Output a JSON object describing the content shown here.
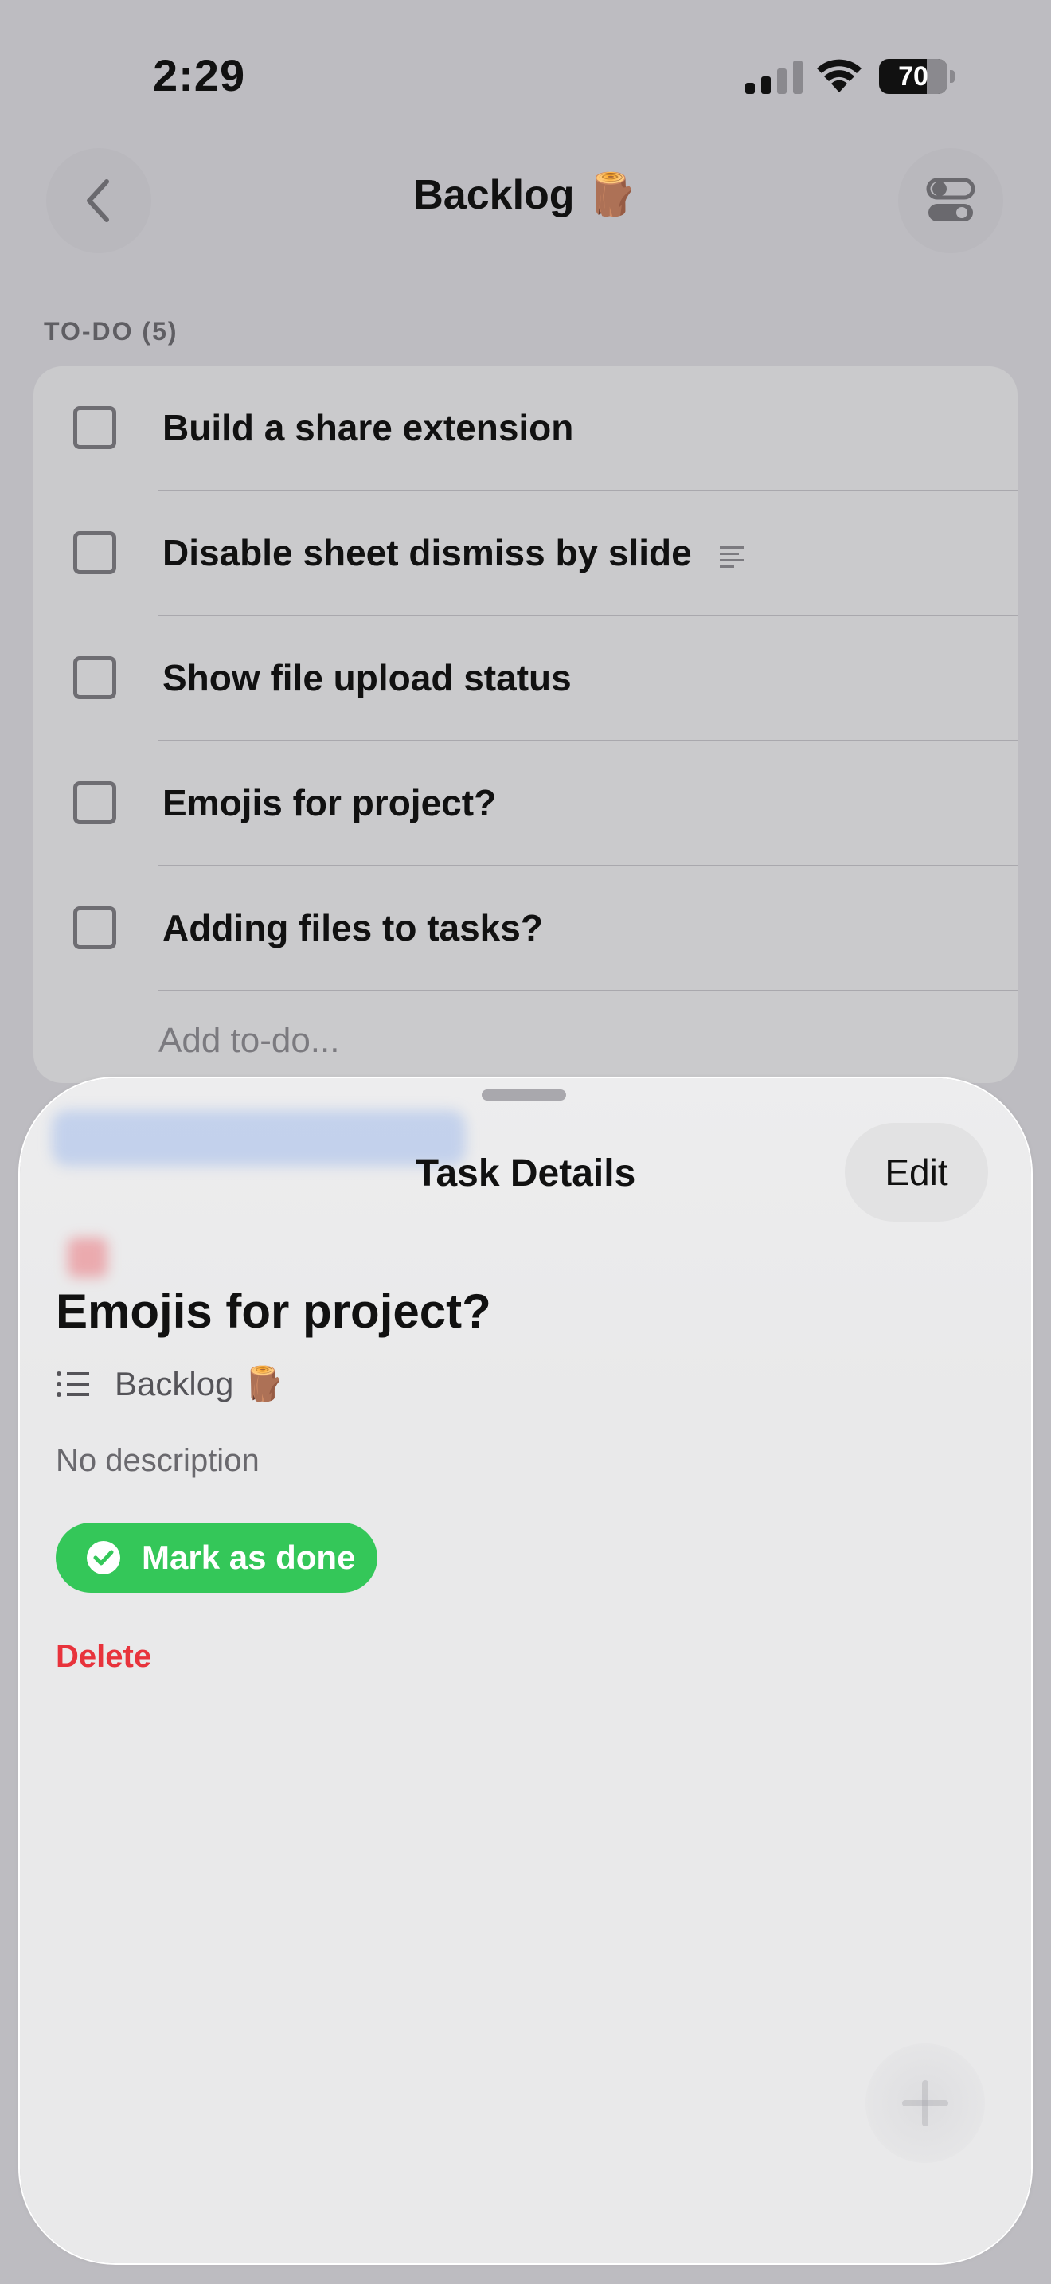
{
  "status_bar": {
    "time": "2:29",
    "battery_level": "70",
    "battery_fraction": 0.7,
    "signal_bars": 2,
    "wifi": true
  },
  "nav": {
    "title": "Backlog 🪵",
    "back_icon": "chevron-left-icon",
    "settings_icon": "toggles-icon"
  },
  "section": {
    "header": "TO-DO (5)"
  },
  "todos": [
    {
      "label": "Build a share extension",
      "has_notes": false,
      "checked": false
    },
    {
      "label": "Disable sheet dismiss by slide",
      "has_notes": true,
      "checked": false
    },
    {
      "label": "Show file upload status",
      "has_notes": false,
      "checked": false
    },
    {
      "label": "Emojis for project?",
      "has_notes": false,
      "checked": false
    },
    {
      "label": "Adding files to tasks?",
      "has_notes": false,
      "checked": false
    }
  ],
  "add_todo_placeholder": "Add to-do...",
  "sheet": {
    "title": "Task Details",
    "edit_label": "Edit",
    "task_title": "Emojis for project?",
    "project_label": "Backlog 🪵",
    "description": "No description",
    "mark_done_label": "Mark as done",
    "delete_label": "Delete"
  },
  "colors": {
    "background": "#bdbcc1",
    "card": "#cacacc",
    "sheet": "#ebebec",
    "accent_green": "#34c759",
    "danger_red": "#e8333c",
    "text_primary": "#111111",
    "text_secondary": "#5f5e63"
  }
}
